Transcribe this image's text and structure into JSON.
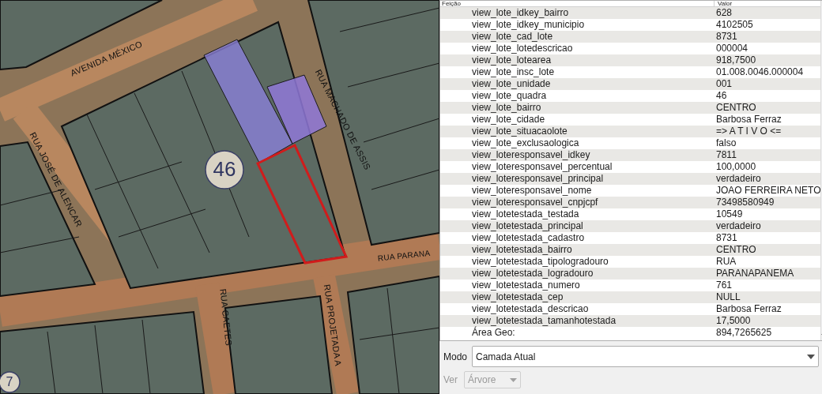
{
  "map": {
    "labels": [
      {
        "kind": "street",
        "text": "AVENIDA MÉXICO"
      },
      {
        "kind": "street",
        "text": "RUA JOSÉ DE ALENCAR"
      },
      {
        "kind": "street",
        "text": "RUA MACHADO DE ASSIS"
      },
      {
        "kind": "street",
        "text": "RUA PARANA"
      },
      {
        "kind": "street",
        "text": "RUA CAETES"
      },
      {
        "kind": "street",
        "text": "RUA PROJETADA A"
      },
      {
        "kind": "block",
        "text": "46"
      },
      {
        "kind": "block",
        "text": "7"
      }
    ]
  },
  "attributes": {
    "columns": [
      "Feição",
      "Valor"
    ],
    "rows": [
      {
        "field": "view_lote_idkey_bairro",
        "value": "628"
      },
      {
        "field": "view_lote_idkey_municipio",
        "value": "4102505"
      },
      {
        "field": "view_lote_cad_lote",
        "value": "8731"
      },
      {
        "field": "view_lote_lotedescricao",
        "value": "000004"
      },
      {
        "field": "view_lote_lotearea",
        "value": "918,7500"
      },
      {
        "field": "view_lote_insc_lote",
        "value": "01.008.0046.000004"
      },
      {
        "field": "view_lote_unidade",
        "value": "001"
      },
      {
        "field": "view_lote_quadra",
        "value": "46"
      },
      {
        "field": "view_lote_bairro",
        "value": "CENTRO"
      },
      {
        "field": "view_lote_cidade",
        "value": "Barbosa Ferraz"
      },
      {
        "field": "view_lote_situacaolote",
        "value": "=> A T I V O <="
      },
      {
        "field": "view_lote_exclusaologica",
        "value": "falso"
      },
      {
        "field": "view_loteresponsavel_idkey",
        "value": "7811"
      },
      {
        "field": "view_loteresponsavel_percentual",
        "value": "100,0000"
      },
      {
        "field": "view_loteresponsavel_principal",
        "value": "verdadeiro"
      },
      {
        "field": "view_loteresponsavel_nome",
        "value": "JOAO FERREIRA NETO"
      },
      {
        "field": "view_loteresponsavel_cnpjcpf",
        "value": "73498580949"
      },
      {
        "field": "view_lotetestada_testada",
        "value": "10549"
      },
      {
        "field": "view_lotetestada_principal",
        "value": "verdadeiro"
      },
      {
        "field": "view_lotetestada_cadastro",
        "value": "8731"
      },
      {
        "field": "view_lotetestada_bairro",
        "value": "CENTRO"
      },
      {
        "field": "view_lotetestada_tipologradouro",
        "value": "RUA"
      },
      {
        "field": "view_lotetestada_logradouro",
        "value": "PARANAPANEMA"
      },
      {
        "field": "view_lotetestada_numero",
        "value": "761"
      },
      {
        "field": "view_lotetestada_cep",
        "value": "NULL"
      },
      {
        "field": "view_lotetestada_descricao",
        "value": "Barbosa Ferraz"
      },
      {
        "field": "view_lotetestada_tamanhotestada",
        "value": "17,5000"
      },
      {
        "field": "Área Geo:",
        "value": "894,7265625"
      }
    ]
  },
  "mode": {
    "label": "Modo",
    "value": "Camada Atual",
    "disabled": false
  },
  "view": {
    "label": "Ver",
    "value": "Árvore",
    "disabled": true
  }
}
